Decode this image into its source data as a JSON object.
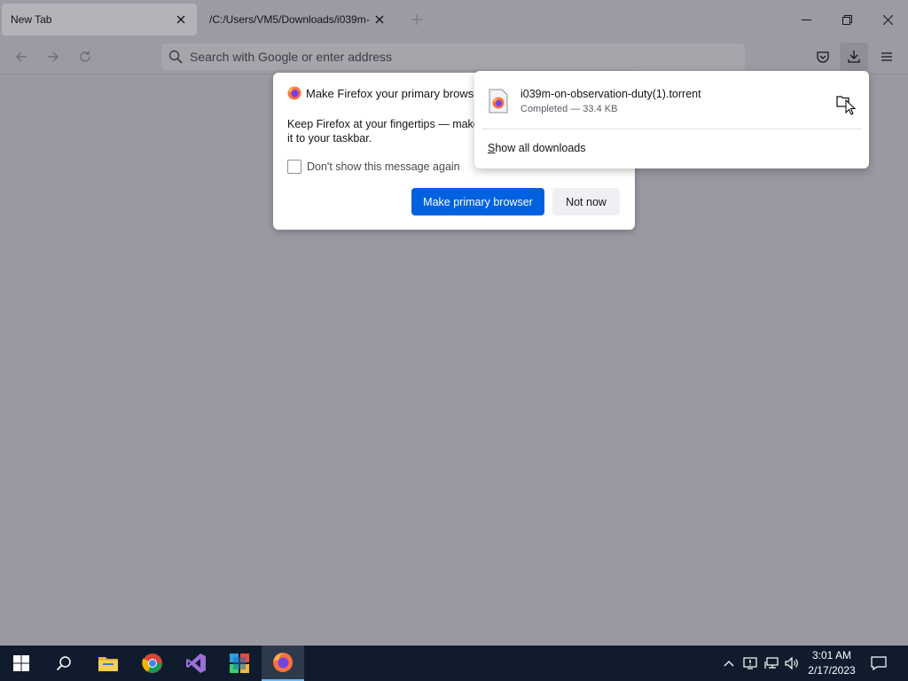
{
  "tabs": [
    {
      "title": "New Tab",
      "active": true
    },
    {
      "title": "/C:/Users/VM5/Downloads/i039m-",
      "active": false
    }
  ],
  "toolbar": {
    "search_placeholder": "Search with Google or enter address"
  },
  "dialog": {
    "title": "Make Firefox your primary browser?",
    "body": "Keep Firefox at your fingertips — make it your primary browser and pin it to your taskbar.",
    "body_line1": "Keep Firefox at your fingertips — make i",
    "body_line2": "it to your taskbar.",
    "checkbox_label": "Don't show this message again",
    "primary_button": "Make primary browser",
    "secondary_button": "Not now"
  },
  "downloads": {
    "items": [
      {
        "filename": "i039m-on-observation-duty(1).torrent",
        "status": "Completed — 33.4 KB"
      }
    ],
    "show_all_first": "S",
    "show_all_rest": "how all downloads"
  },
  "taskbar": {
    "apps": [
      "start",
      "search",
      "file-explorer",
      "chrome",
      "visual-studio",
      "windows-store",
      "firefox"
    ],
    "time": "3:01 AM",
    "date": "2/17/2023"
  },
  "colors": {
    "primary_button": "#0061e0",
    "taskbar": "#101c2d",
    "chrome_bg": "#9c9ba3"
  }
}
